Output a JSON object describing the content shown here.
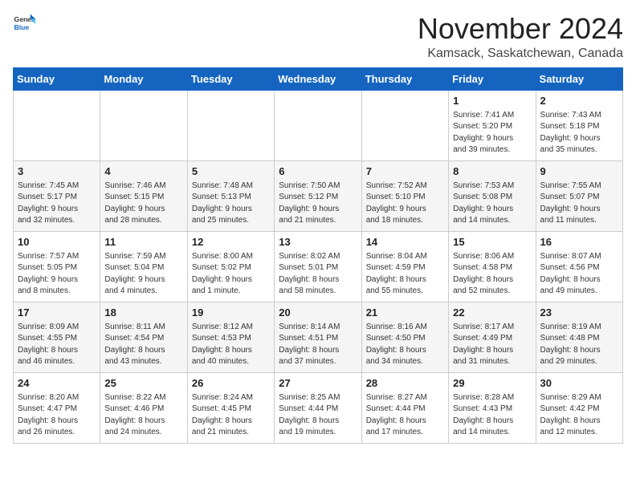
{
  "logo": {
    "general": "General",
    "blue": "Blue"
  },
  "title": "November 2024",
  "location": "Kamsack, Saskatchewan, Canada",
  "weekdays": [
    "Sunday",
    "Monday",
    "Tuesday",
    "Wednesday",
    "Thursday",
    "Friday",
    "Saturday"
  ],
  "weeks": [
    [
      {
        "day": "",
        "info": ""
      },
      {
        "day": "",
        "info": ""
      },
      {
        "day": "",
        "info": ""
      },
      {
        "day": "",
        "info": ""
      },
      {
        "day": "",
        "info": ""
      },
      {
        "day": "1",
        "info": "Sunrise: 7:41 AM\nSunset: 5:20 PM\nDaylight: 9 hours\nand 39 minutes."
      },
      {
        "day": "2",
        "info": "Sunrise: 7:43 AM\nSunset: 5:18 PM\nDaylight: 9 hours\nand 35 minutes."
      }
    ],
    [
      {
        "day": "3",
        "info": "Sunrise: 7:45 AM\nSunset: 5:17 PM\nDaylight: 9 hours\nand 32 minutes."
      },
      {
        "day": "4",
        "info": "Sunrise: 7:46 AM\nSunset: 5:15 PM\nDaylight: 9 hours\nand 28 minutes."
      },
      {
        "day": "5",
        "info": "Sunrise: 7:48 AM\nSunset: 5:13 PM\nDaylight: 9 hours\nand 25 minutes."
      },
      {
        "day": "6",
        "info": "Sunrise: 7:50 AM\nSunset: 5:12 PM\nDaylight: 9 hours\nand 21 minutes."
      },
      {
        "day": "7",
        "info": "Sunrise: 7:52 AM\nSunset: 5:10 PM\nDaylight: 9 hours\nand 18 minutes."
      },
      {
        "day": "8",
        "info": "Sunrise: 7:53 AM\nSunset: 5:08 PM\nDaylight: 9 hours\nand 14 minutes."
      },
      {
        "day": "9",
        "info": "Sunrise: 7:55 AM\nSunset: 5:07 PM\nDaylight: 9 hours\nand 11 minutes."
      }
    ],
    [
      {
        "day": "10",
        "info": "Sunrise: 7:57 AM\nSunset: 5:05 PM\nDaylight: 9 hours\nand 8 minutes."
      },
      {
        "day": "11",
        "info": "Sunrise: 7:59 AM\nSunset: 5:04 PM\nDaylight: 9 hours\nand 4 minutes."
      },
      {
        "day": "12",
        "info": "Sunrise: 8:00 AM\nSunset: 5:02 PM\nDaylight: 9 hours\nand 1 minute."
      },
      {
        "day": "13",
        "info": "Sunrise: 8:02 AM\nSunset: 5:01 PM\nDaylight: 8 hours\nand 58 minutes."
      },
      {
        "day": "14",
        "info": "Sunrise: 8:04 AM\nSunset: 4:59 PM\nDaylight: 8 hours\nand 55 minutes."
      },
      {
        "day": "15",
        "info": "Sunrise: 8:06 AM\nSunset: 4:58 PM\nDaylight: 8 hours\nand 52 minutes."
      },
      {
        "day": "16",
        "info": "Sunrise: 8:07 AM\nSunset: 4:56 PM\nDaylight: 8 hours\nand 49 minutes."
      }
    ],
    [
      {
        "day": "17",
        "info": "Sunrise: 8:09 AM\nSunset: 4:55 PM\nDaylight: 8 hours\nand 46 minutes."
      },
      {
        "day": "18",
        "info": "Sunrise: 8:11 AM\nSunset: 4:54 PM\nDaylight: 8 hours\nand 43 minutes."
      },
      {
        "day": "19",
        "info": "Sunrise: 8:12 AM\nSunset: 4:53 PM\nDaylight: 8 hours\nand 40 minutes."
      },
      {
        "day": "20",
        "info": "Sunrise: 8:14 AM\nSunset: 4:51 PM\nDaylight: 8 hours\nand 37 minutes."
      },
      {
        "day": "21",
        "info": "Sunrise: 8:16 AM\nSunset: 4:50 PM\nDaylight: 8 hours\nand 34 minutes."
      },
      {
        "day": "22",
        "info": "Sunrise: 8:17 AM\nSunset: 4:49 PM\nDaylight: 8 hours\nand 31 minutes."
      },
      {
        "day": "23",
        "info": "Sunrise: 8:19 AM\nSunset: 4:48 PM\nDaylight: 8 hours\nand 29 minutes."
      }
    ],
    [
      {
        "day": "24",
        "info": "Sunrise: 8:20 AM\nSunset: 4:47 PM\nDaylight: 8 hours\nand 26 minutes."
      },
      {
        "day": "25",
        "info": "Sunrise: 8:22 AM\nSunset: 4:46 PM\nDaylight: 8 hours\nand 24 minutes."
      },
      {
        "day": "26",
        "info": "Sunrise: 8:24 AM\nSunset: 4:45 PM\nDaylight: 8 hours\nand 21 minutes."
      },
      {
        "day": "27",
        "info": "Sunrise: 8:25 AM\nSunset: 4:44 PM\nDaylight: 8 hours\nand 19 minutes."
      },
      {
        "day": "28",
        "info": "Sunrise: 8:27 AM\nSunset: 4:44 PM\nDaylight: 8 hours\nand 17 minutes."
      },
      {
        "day": "29",
        "info": "Sunrise: 8:28 AM\nSunset: 4:43 PM\nDaylight: 8 hours\nand 14 minutes."
      },
      {
        "day": "30",
        "info": "Sunrise: 8:29 AM\nSunset: 4:42 PM\nDaylight: 8 hours\nand 12 minutes."
      }
    ]
  ]
}
